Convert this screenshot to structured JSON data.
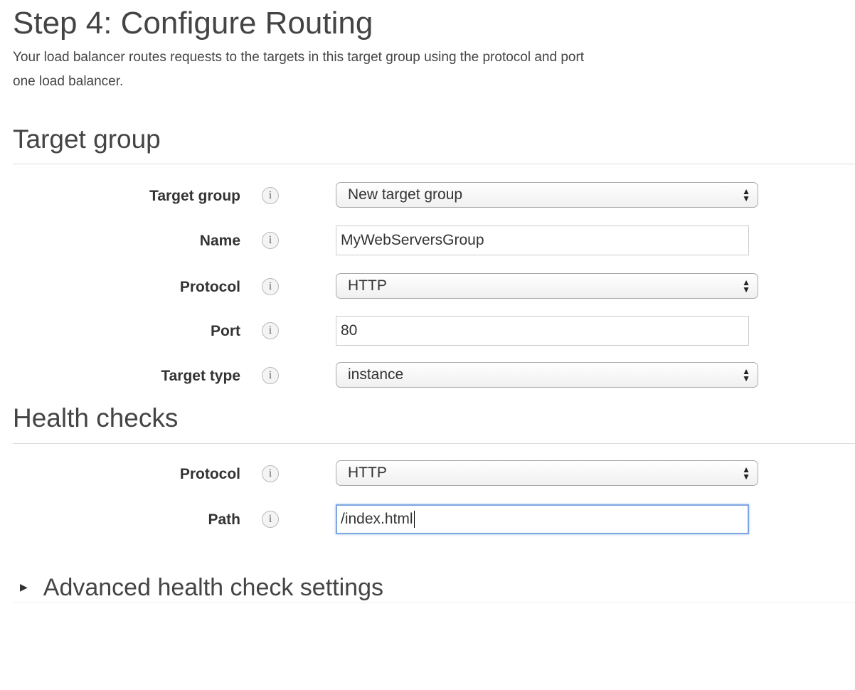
{
  "header": {
    "title": "Step 4: Configure Routing",
    "description_line1": "Your load balancer routes requests to the targets in this target group using the protocol and port",
    "description_line2": "one load balancer."
  },
  "target_group_section": {
    "title": "Target group",
    "rows": [
      {
        "label": "Target group",
        "type": "select",
        "value": "New target group"
      },
      {
        "label": "Name",
        "type": "input",
        "value": "MyWebServersGroup"
      },
      {
        "label": "Protocol",
        "type": "select",
        "value": "HTTP"
      },
      {
        "label": "Port",
        "type": "input",
        "value": "80"
      },
      {
        "label": "Target type",
        "type": "select",
        "value": "instance"
      }
    ]
  },
  "health_checks_section": {
    "title": "Health checks",
    "rows": [
      {
        "label": "Protocol",
        "type": "select",
        "value": "HTTP"
      },
      {
        "label": "Path",
        "type": "input",
        "value": "/index.html",
        "focused": true
      }
    ]
  },
  "advanced": {
    "label": "Advanced health check settings",
    "expander_icon": "triangle-right-icon"
  },
  "icons": {
    "info": "i",
    "select_arrows": "updown-arrows-icon",
    "expander": "▶"
  },
  "colors": {
    "focus_border": "#7ea6e0",
    "text": "#333333",
    "heading": "#444444",
    "divider": "#dddddd"
  }
}
